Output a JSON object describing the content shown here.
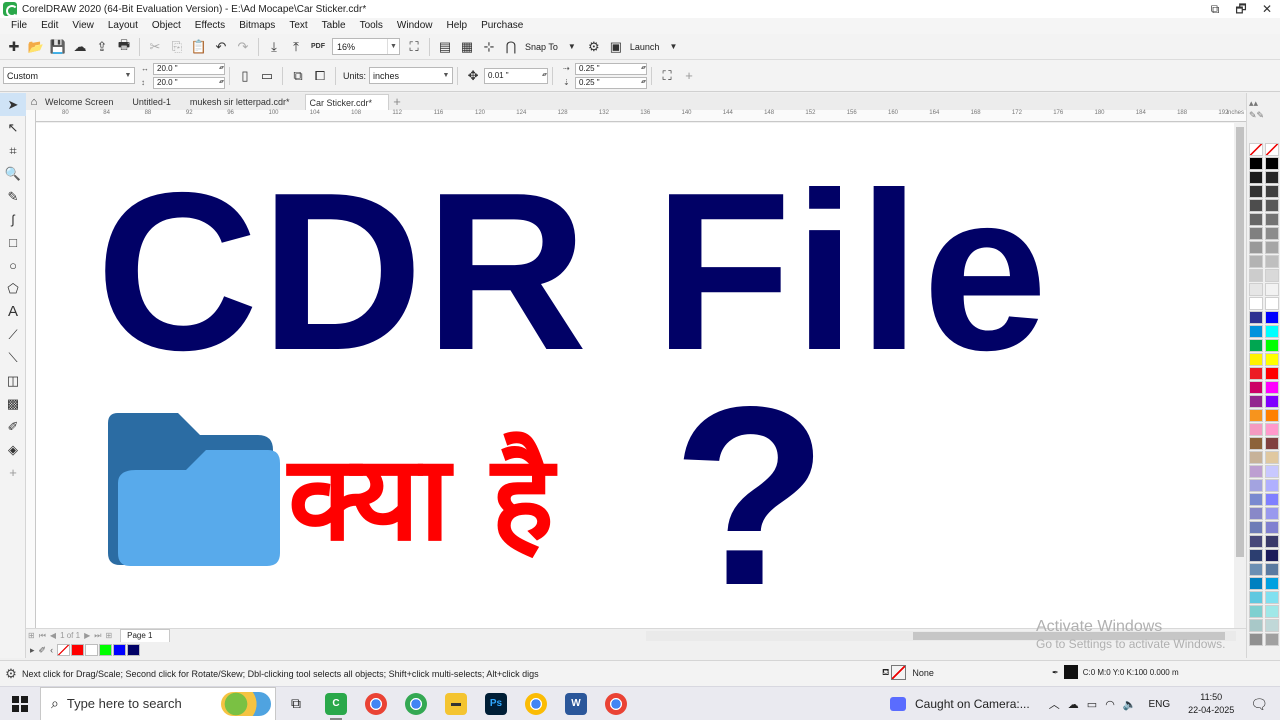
{
  "window": {
    "title": "CorelDRAW 2020 (64-Bit Evaluation Version) - E:\\Ad Mocape\\Car Sticker.cdr*",
    "controls": [
      "⧉",
      "🗗",
      "✕"
    ]
  },
  "menu": [
    "File",
    "Edit",
    "View",
    "Layout",
    "Object",
    "Effects",
    "Bitmaps",
    "Text",
    "Table",
    "Tools",
    "Window",
    "Help",
    "Purchase"
  ],
  "toolbar": {
    "zoom": "16%",
    "snap_to": "Snap To",
    "launch": "Launch",
    "pdf": "PDF"
  },
  "propbar": {
    "page_size": "Custom",
    "width": "20.0 \"",
    "height": "20.0 \"",
    "units_label": "Units:",
    "units_value": "inches",
    "nudge": "0.01 \"",
    "dup_x": "0.25 \"",
    "dup_y": "0.25 \""
  },
  "tabs": {
    "items": [
      "Welcome Screen",
      "Untitled-1",
      "mukesh sir letterpad.cdr*",
      "Car Sticker.cdr*"
    ],
    "active_index": 3
  },
  "ruler": {
    "labels": [
      "80",
      "84",
      "88",
      "92",
      "96",
      "100",
      "104",
      "108",
      "112",
      "116",
      "120",
      "124",
      "128",
      "132",
      "136",
      "140",
      "144",
      "148",
      "152",
      "156",
      "160",
      "164",
      "168",
      "172",
      "176",
      "180",
      "184",
      "188",
      "192"
    ],
    "unit": "inches"
  },
  "canvas": {
    "heading": "CDR File",
    "hindi": "क्या है",
    "question": "?",
    "heading_color": "#010166",
    "hindi_color": "#ff0000",
    "folder_dark": "#2b6ca3",
    "folder_light": "#58aaeb"
  },
  "watermark": {
    "title": "Activate Windows",
    "subtitle": "Go to Settings to activate Windows."
  },
  "page_nav": {
    "of": "1 of 1",
    "page": "Page 1"
  },
  "palette": {
    "col1": [
      "#000000",
      "#1a1a1a",
      "#333333",
      "#4d4d4d",
      "#666666",
      "#808080",
      "#999999",
      "#b3b3b3",
      "#cccccc",
      "#e6e6e6",
      "#ffffff",
      "#2e3192",
      "#0093dd",
      "#00a651",
      "#fff200",
      "#ed1c24",
      "#cc0066",
      "#92278f",
      "#f7941d",
      "#f49ac1",
      "#8c6239",
      "#c7b299",
      "#bd9fd1",
      "#a3a3e0",
      "#7a8ad0",
      "#8888c8",
      "#6d7bb7",
      "#48487a",
      "#2c3e70",
      "#6b8fb3",
      "#0080c0",
      "#5fc8e0",
      "#7fd0d0",
      "#a8c8c8",
      "#909090"
    ],
    "col2": [
      "#000000",
      "#262626",
      "#404040",
      "#595959",
      "#737373",
      "#8c8c8c",
      "#a6a6a6",
      "#bfbfbf",
      "#d9d9d9",
      "#f2f2f2",
      "#ffffff",
      "#0000ff",
      "#00ffff",
      "#00ff00",
      "#ffff00",
      "#ff0000",
      "#ff00ff",
      "#8000ff",
      "#ff8000",
      "#ff99cc",
      "#804040",
      "#e0c8a0",
      "#c8c8ff",
      "#b0b0ff",
      "#8080ff",
      "#9999ee",
      "#8080d0",
      "#3a3a6a",
      "#1a1a5a",
      "#5a7aa0",
      "#00a0e0",
      "#80e0f0",
      "#a0e8e8",
      "#c0d8d8",
      "#a0a0a0"
    ]
  },
  "doc_palette": [
    "#ff0000",
    "#ffffff",
    "#00ff00",
    "#0000ff",
    "#010166"
  ],
  "status": {
    "hint": "Next click for Drag/Scale; Second click for Rotate/Skew; Dbl-clicking tool selects all objects; Shift+click multi-selects; Alt+click digs",
    "fill": "None",
    "outline": "C:0 M:0 Y:0 K:100  0.000 m"
  },
  "taskbar": {
    "search_placeholder": "Type here to search",
    "notification": "Caught on Camera:...",
    "language": "ENG",
    "time": "11:50",
    "date": "22-04-2025"
  }
}
